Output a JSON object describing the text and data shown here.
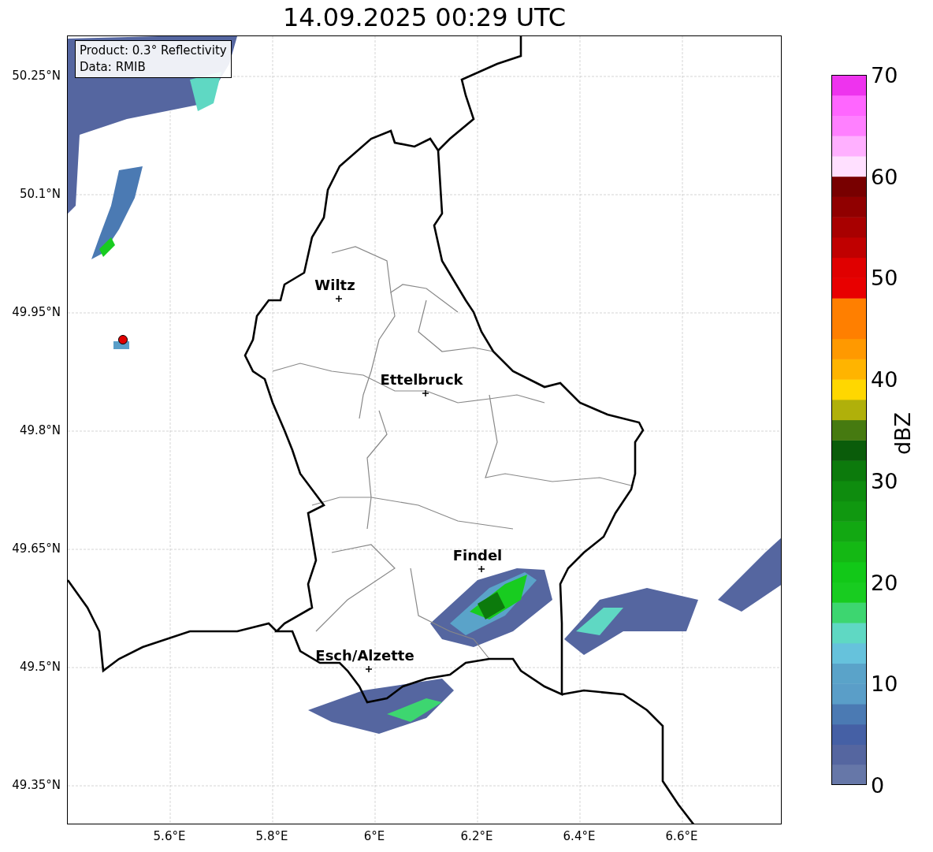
{
  "title": "14.09.2025 00:29 UTC",
  "legend": [
    "Product: 0.3° Reflectivity",
    "Data: RMIB"
  ],
  "y_ticks": [
    "50.25°N",
    "50.1°N",
    "49.95°N",
    "49.8°N",
    "49.65°N",
    "49.5°N",
    "49.35°N"
  ],
  "x_ticks": [
    "5.6°E",
    "5.8°E",
    "6°E",
    "6.2°E",
    "6.4°E",
    "6.6°E"
  ],
  "cities": [
    {
      "name": "Wiltz"
    },
    {
      "name": "Ettelbruck"
    },
    {
      "name": "Findel"
    },
    {
      "name": "Esch/Alzette"
    }
  ],
  "colorbar": {
    "ticks": [
      "70",
      "60",
      "50",
      "40",
      "30",
      "20",
      "10",
      "0"
    ],
    "label": "dBZ"
  }
}
